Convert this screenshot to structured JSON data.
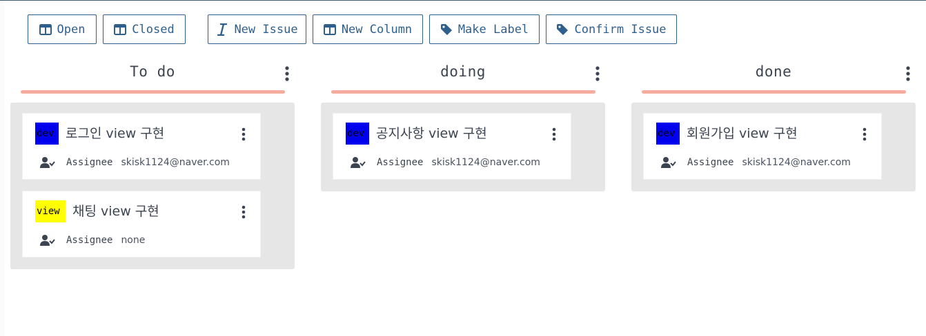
{
  "toolbar": {
    "buttons": [
      {
        "label": "Open",
        "icon": "columns-icon"
      },
      {
        "label": "Closed",
        "icon": "columns-icon"
      },
      {
        "label": "New Issue",
        "icon": "italic-i-icon"
      },
      {
        "label": "New Column",
        "icon": "columns-icon"
      },
      {
        "label": "Make Label",
        "icon": "tag-icon"
      },
      {
        "label": "Confirm Issue",
        "icon": "tag-icon"
      }
    ]
  },
  "colors": {
    "accent": "#2f5f8c",
    "column_underline": "#f5ab9e",
    "column_background": "#e6e6e6",
    "label_dev": "#0000ee",
    "label_view": "#ffff00"
  },
  "columns": [
    {
      "title": "To do",
      "cards": [
        {
          "label": "dev",
          "label_color": "#0000ee",
          "title": "로그인 view 구현",
          "assignee_label": "Assignee",
          "assignee": "skisk1124@naver.com"
        },
        {
          "label": "view",
          "label_color": "#ffff00",
          "title": "채팅 view 구현",
          "assignee_label": "Assignee",
          "assignee": "none"
        }
      ]
    },
    {
      "title": "doing",
      "cards": [
        {
          "label": "dev",
          "label_color": "#0000ee",
          "title": "공지사항 view 구현",
          "assignee_label": "Assignee",
          "assignee": "skisk1124@naver.com"
        }
      ]
    },
    {
      "title": "done",
      "cards": [
        {
          "label": "dev",
          "label_color": "#0000ee",
          "title": "회원가입 view 구현",
          "assignee_label": "Assignee",
          "assignee": "skisk1124@naver.com"
        }
      ]
    }
  ]
}
